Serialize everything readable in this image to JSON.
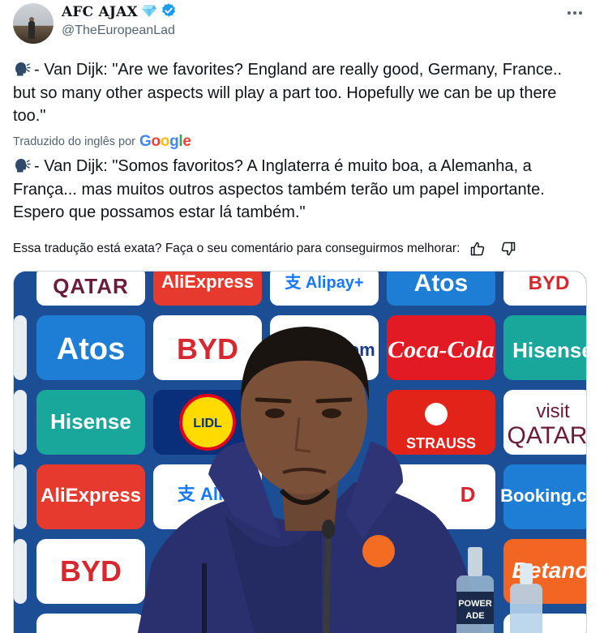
{
  "author": {
    "display_name": "AFC AJAX",
    "handle": "@TheEuropeanLad",
    "avatar_icon": "profile-photo",
    "badge_icons": [
      "diamond-icon",
      "verified-badge-icon"
    ]
  },
  "tweet": {
    "original_text": "- Van Dijk: \"Are we favorites? England are really good, Germany, France.. but so many other aspects will play a part too. Hopefully we can be up there too.\"",
    "translated_by_label": "Traduzido do inglês por",
    "translator_brand": "Google",
    "translated_text": "- Van Dijk: \"Somos favoritos? A Inglaterra é muito boa, a Alemanha, a França... mas muitos outros aspectos também terão um papel importante. Espero que possamos estar lá também.\"",
    "speaker_icon": "speaking-head-emoji"
  },
  "feedback": {
    "question": "Essa tradução está exata? Faça o seu comentário para conseguirmos melhorar:",
    "like_icon": "thumbs-up-icon",
    "dislike_icon": "thumbs-down-icon"
  },
  "media": {
    "backdrop_sponsors": [
      "QATAR",
      "AliExpress",
      "Alipay",
      "Atos",
      "BYD",
      "Booking.com",
      "Coca-Cola",
      "Hisense",
      "LIDL",
      "visit QATAR",
      "STRAUSS",
      "Betano"
    ],
    "bottle_label": "POWER ADE"
  },
  "colors": {
    "text_primary": "#0f1419",
    "text_secondary": "#536471",
    "verified_blue": "#1d9bf0",
    "backdrop_blue": "#1b4e94"
  }
}
